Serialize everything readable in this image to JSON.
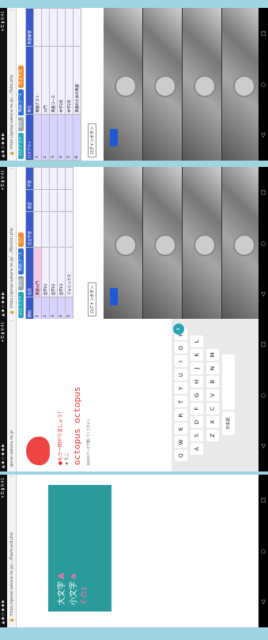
{
  "status": {
    "left": "▲ ◆ ◇ ◆ ◆ ▶",
    "right": "▾ ⚿ ▮ 9:41"
  },
  "panels": [
    {
      "url": "https://gonai.sakura.ne.jp/.../Tabs.php",
      "tabs": [
        "ログアウト",
        "名前",
        "英語コース",
        "自主学習"
      ],
      "table": [
        [
          "ログアウト",
          "単元",
          "英語練習"
        ],
        [
          "1",
          "単語テスト",
          ""
        ],
        [
          "2",
          "入門",
          ""
        ],
        [
          "3",
          "英語コース",
          ""
        ],
        [
          "4",
          "中学1年",
          ""
        ],
        [
          "5",
          "中学2年",
          ""
        ],
        [
          "6",
          "英語のための英語",
          ""
        ]
      ],
      "toast": "ログインボタン"
    },
    {
      "url": "https://gonai.sakura.ne.jp/.../Monitor.php",
      "tabs": [
        "ログアウト",
        "名前",
        "英語コース",
        "ログ"
      ],
      "table": [
        [
          "開始",
          "名前",
          "自主学習",
          "進度",
          "学習"
        ],
        [
          "1",
          "英語入門",
          "",
          "",
          ""
        ],
        [
          "2",
          "自学01",
          "",
          "",
          ""
        ],
        [
          "3",
          "自学02",
          "",
          "",
          ""
        ],
        [
          "4",
          "自学03",
          "",
          "",
          ""
        ],
        [
          "5",
          "フォニックス",
          "",
          "",
          ""
        ]
      ],
      "toast": "ログインボタン"
    },
    {
      "url": "gonai.sakura.ne.jp",
      "prompt": "●もう一回やりましょう！",
      "word": "octopus  octopus",
      "hint": "★ たこ",
      "footer": "自分のペースで聞いてくりかえし",
      "keys": [
        [
          "Q",
          "W",
          "E",
          "R",
          "T",
          "Y",
          "U",
          "I",
          "O",
          "P"
        ],
        [
          "A",
          "S",
          "D",
          "F",
          "G",
          "H",
          "J",
          "K",
          "L"
        ],
        [
          "Z",
          "X",
          "C",
          "V",
          "B",
          "N",
          "M"
        ]
      ],
      "mic_label": "日本語"
    },
    {
      "url": "https://gonai.sakura.ne.jp/.../flashcard.php",
      "slide_line1": "大文字",
      "slide_line2": "小文字",
      "letter_big": "A",
      "letter_small": "a",
      "slide_caption": "その1"
    }
  ],
  "nav": [
    "◁",
    "○",
    "□"
  ]
}
